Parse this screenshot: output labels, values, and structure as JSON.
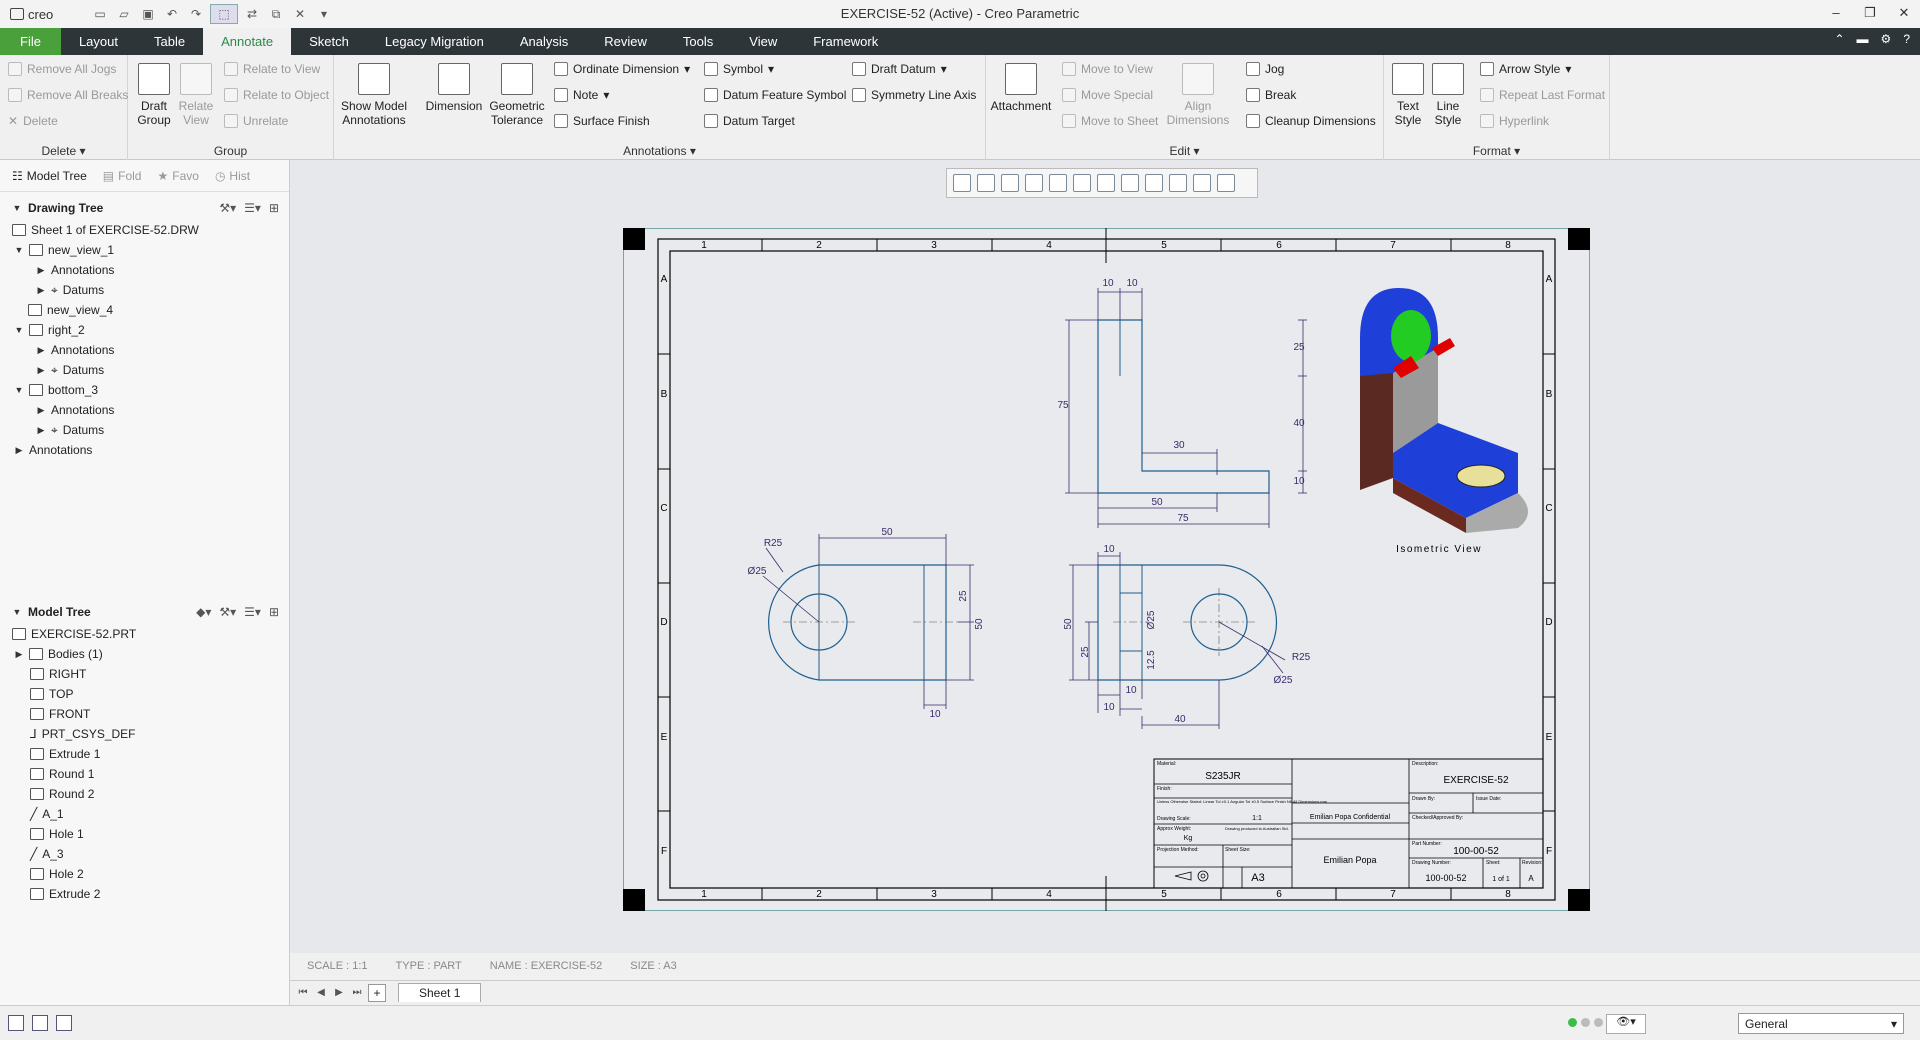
{
  "app": {
    "window_title": "EXERCISE-52 (Active) - Creo Parametric",
    "brand": "creo"
  },
  "ribbon_tabs": [
    "File",
    "Layout",
    "Table",
    "Annotate",
    "Sketch",
    "Legacy Migration",
    "Analysis",
    "Review",
    "Tools",
    "View",
    "Framework"
  ],
  "active_tab": "Annotate",
  "groups": {
    "delete": {
      "title": "Delete",
      "items": [
        "Remove All Jogs",
        "Remove All Breaks",
        "Delete"
      ]
    },
    "group": {
      "title": "Group",
      "draft_group": "Draft Group",
      "relate_view": "Relate View",
      "items": [
        "Relate to View",
        "Relate to Object",
        "Unrelate"
      ]
    },
    "annotations": {
      "title": "Annotations",
      "show_model": "Show Model Annotations",
      "dimension": "Dimension",
      "geometric_tolerance": "Geometric Tolerance",
      "col1": [
        "Ordinate Dimension",
        "Note",
        "Surface Finish"
      ],
      "col2": [
        "Symbol",
        "Datum Feature Symbol",
        "Datum Target"
      ],
      "col3": [
        "Draft Datum",
        "Symmetry Line Axis"
      ]
    },
    "edit": {
      "title": "Edit",
      "attachment": "Attachment",
      "align": "Align Dimensions",
      "col1": [
        "Move to View",
        "Move Special",
        "Move to Sheet"
      ],
      "col2": [
        "Jog",
        "Break",
        "Cleanup Dimensions"
      ]
    },
    "format": {
      "title": "Format",
      "text_style": "Text Style",
      "line_style": "Line Style",
      "items": [
        "Arrow Style",
        "Repeat Last Format",
        "Hyperlink"
      ]
    }
  },
  "panel": {
    "tabs": [
      "Model Tree",
      "Fold",
      "Favo",
      "Hist"
    ],
    "drawing_tree": {
      "title": "Drawing Tree",
      "nodes": [
        "Sheet 1 of EXERCISE-52.DRW",
        "new_view_1",
        "Annotations",
        "Datums",
        "new_view_4",
        "right_2",
        "Annotations",
        "Datums",
        "bottom_3",
        "Annotations",
        "Datums",
        "Annotations"
      ]
    },
    "model_tree": {
      "title": "Model Tree",
      "nodes": [
        "EXERCISE-52.PRT",
        "Bodies (1)",
        "RIGHT",
        "TOP",
        "FRONT",
        "PRT_CSYS_DEF",
        "Extrude 1",
        "Round 1",
        "Round 2",
        "A_1",
        "Hole 1",
        "A_3",
        "Hole 2",
        "Extrude 2"
      ]
    }
  },
  "drawing": {
    "col_labels": [
      "1",
      "2",
      "3",
      "4",
      "5",
      "6",
      "7",
      "8"
    ],
    "row_labels": [
      "A",
      "B",
      "C",
      "D",
      "E",
      "F"
    ],
    "iso_label": "Isometric View",
    "dims": {
      "d50": "50",
      "d25": "25",
      "d75": "75",
      "d40": "40",
      "d30": "30",
      "d10": "10",
      "d125": "12.5",
      "r25": "R25",
      "dia25": "Ø25"
    },
    "titleblock": {
      "material_label": "Material:",
      "material": "S235JR",
      "finish_label": "Finish:",
      "general_tol": "Unless Otherwise Stated: Linear Tol ±0.1 Angular Tol ±0.5 Surface Finish N6 All Dimensions mm",
      "drawing_scale_label": "Drawing Scale:",
      "drawing_scale": "1:1",
      "approx_weight_label": "Approx Weight:",
      "approx_weight": "Kg",
      "drawing_std": "Drawing produced to Australian Std.",
      "projection_label": "Projection Method:",
      "sheet_size_label": "Sheet Size:",
      "sheet_size": "A3",
      "confidential": "Emilian Popa Confidential",
      "drawn_by": "Emilian Popa",
      "description_label": "Description:",
      "description": "EXERCISE-52",
      "drawn_label": "Drawn By:",
      "date_label": "Issue Date:",
      "checked_label": "Checked/Approved By:",
      "part_number_label": "Part Number:",
      "part_number": "100-00-52",
      "drawing_number_label": "Drawing Number:",
      "drawing_number": "100-00-52",
      "sheet_label": "Sheet:",
      "sheet": "1 of 1",
      "revision_label": "Revision:",
      "revision": "A"
    }
  },
  "status": {
    "scale": "SCALE : 1:1",
    "type": "TYPE : PART",
    "name": "NAME : EXERCISE-52",
    "size": "SIZE : A3"
  },
  "sheet_tab": "Sheet 1",
  "filter": "General"
}
